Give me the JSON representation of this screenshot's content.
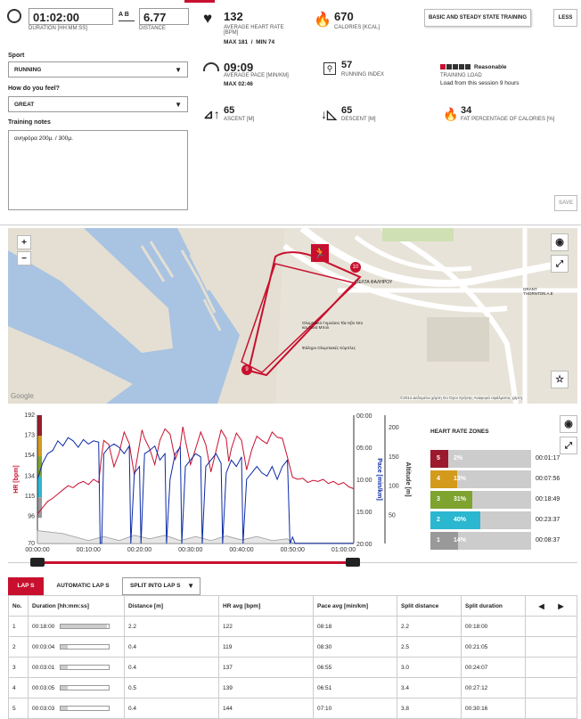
{
  "summary": {
    "duration": {
      "value": "01:02:00",
      "label": "DURATION [hh:mm:ss]"
    },
    "distance": {
      "icon_text": "A B",
      "value": "6.77",
      "label": "DISTANCE"
    },
    "avg_hr": {
      "value": "132",
      "label": "AVERAGE HEART RATE [bpm]",
      "sub": "MAX 181  /  MIN 74"
    },
    "calories": {
      "value": "670",
      "label": "CALORIES [kcal]"
    },
    "avg_pace": {
      "value": "09:09",
      "label": "AVERAGE PACE [min/km]",
      "sub": "MAX 02:46"
    },
    "running_index": {
      "value": "57",
      "label": "RUNNING INDEX"
    },
    "training_load": {
      "value": "Reasonable",
      "label": "TRAINING LOAD",
      "sub": "Load from this session 9 hours"
    },
    "ascent": {
      "value": "65",
      "label": "ASCENT [m]"
    },
    "descent": {
      "value": "65",
      "label": "DESCENT [m]"
    },
    "fat": {
      "value": "34",
      "label": "FAT PERCENTAGE OF CALORIES [%]"
    },
    "target_button": "BASIC AND STEADY STATE TRAINING",
    "less_button": "LESS",
    "save_button": "SAVE"
  },
  "form": {
    "sport_label": "Sport",
    "sport_value": "RUNNING",
    "feel_label": "How do you feel?",
    "feel_value": "GREAT",
    "notes_label": "Training notes",
    "notes_value": "ανηφόρα 200μ. / 300μ."
  },
  "map": {
    "zoom_in": "+",
    "zoom_out": "−",
    "google": "Google",
    "copyright": "©2014 Δεδομένα χάρτη Go  Όροι Χρήσης  Αναφορά σφάλματος χάρτη",
    "place_station": "ΔΕΛΤΑ ΦΑΛΗΡΟΥ",
    "place_stadium": "Ολυμπιακό Γυμνάσιο Τάε Κβο Ντο και Ξανά Μπολ",
    "place_complex": "Φάληρο Ολυμπιακές Κόμπλες",
    "place_grant": "GRANT THORNTON A.E",
    "marker_start": "9",
    "marker_end": "10"
  },
  "chart_data": {
    "type": "line",
    "x_ticks": [
      "00:00:00",
      "00:10:00",
      "00:20:00",
      "00:30:00",
      "00:40:00",
      "00:50:00",
      "01:00:00"
    ],
    "hr_axis": {
      "label": "HR [bpm]",
      "ticks": [
        "192",
        "173",
        "154",
        "134",
        "115",
        "96",
        "70"
      ]
    },
    "pace_axis": {
      "label": "Pace [min/km]",
      "ticks": [
        "00:00",
        "05:00",
        "10:00",
        "15:00",
        "20:00"
      ]
    },
    "alt_axis": {
      "label": "Altitude [m]",
      "ticks": [
        "200",
        "150",
        "100",
        "50"
      ]
    },
    "xlim": [
      0,
      62
    ],
    "series": [
      {
        "name": "HR [bpm]",
        "color": "#c8102e",
        "x": [
          0,
          1,
          2,
          3,
          4,
          5,
          6,
          7,
          8,
          9,
          10,
          11,
          12,
          12.5,
          13,
          14,
          15,
          16,
          17,
          18,
          19,
          20,
          20.5,
          21,
          22,
          23,
          24,
          25,
          26,
          27,
          28,
          28.5,
          29,
          30,
          31,
          32,
          33,
          34,
          35,
          36,
          37,
          37.5,
          38,
          39,
          40,
          41,
          42,
          43,
          44,
          45,
          46,
          47,
          48,
          49,
          50,
          51,
          52,
          53,
          54,
          55,
          56,
          57,
          58,
          59,
          60,
          61,
          62
        ],
        "values": [
          98,
          104,
          110,
          113,
          117,
          121,
          125,
          123,
          127,
          129,
          126,
          131,
          128,
          150,
          168,
          164,
          143,
          156,
          176,
          165,
          135,
          164,
          178,
          170,
          160,
          145,
          168,
          179,
          174,
          150,
          163,
          181,
          168,
          145,
          160,
          176,
          164,
          138,
          158,
          178,
          170,
          148,
          160,
          175,
          168,
          140,
          159,
          172,
          168,
          165,
          176,
          171,
          170,
          152,
          133,
          131,
          132,
          128,
          130,
          129,
          131,
          127,
          129,
          126,
          128,
          124,
          122
        ]
      },
      {
        "name": "Pace [min/km]",
        "color": "#0a2aa6",
        "x": [
          0,
          1,
          2,
          3,
          4,
          5,
          6,
          7,
          8,
          9,
          10,
          11,
          12,
          12.3,
          12.6,
          13,
          14,
          15,
          16,
          17,
          18,
          18.3,
          19,
          20,
          20.3,
          21,
          22,
          23,
          24,
          25,
          25.3,
          26,
          27,
          28,
          28.3,
          29,
          30,
          31,
          32,
          32.3,
          33,
          34,
          35,
          36,
          36.3,
          37,
          38,
          39,
          40,
          40.3,
          41,
          42,
          43,
          44,
          45,
          46,
          47,
          48,
          49,
          49.5,
          50,
          50.5,
          51,
          52,
          53,
          54,
          55,
          56,
          57,
          58,
          59,
          60,
          61,
          62
        ],
        "values": [
          10,
          7.5,
          6,
          5.5,
          4,
          4.8,
          3.5,
          4,
          5,
          3.8,
          4.5,
          4,
          4.2,
          20,
          20,
          6,
          5,
          4.5,
          5,
          6,
          4.8,
          20,
          9,
          8,
          20,
          6,
          5.5,
          4.8,
          7,
          6,
          20,
          10,
          6,
          5,
          20,
          8,
          7,
          6,
          6.5,
          20,
          8,
          7,
          6,
          7.5,
          20,
          9,
          7,
          8,
          6.5,
          20,
          10,
          9,
          8,
          9,
          9.5,
          8,
          10,
          8,
          7,
          20,
          19,
          20,
          20,
          20,
          20,
          20,
          20,
          20,
          20,
          20,
          20,
          20,
          20,
          20
        ]
      },
      {
        "name": "Altitude [m]",
        "color": "#999999",
        "x": [
          0,
          5,
          10,
          13,
          16,
          19,
          22,
          25,
          28,
          31,
          34,
          37,
          40,
          43,
          46,
          49,
          50,
          52,
          56,
          62
        ],
        "values": [
          22,
          17,
          5,
          12,
          5,
          14,
          8,
          14,
          5,
          12,
          5,
          13,
          6,
          12,
          5,
          8,
          1,
          1,
          1,
          1
        ]
      }
    ],
    "hr_range": [
      70,
      192
    ],
    "pace_range": [
      0,
      20
    ],
    "alt_range": [
      0,
      220
    ]
  },
  "zones": {
    "title": "HEART RATE ZONES",
    "items": [
      {
        "zone": "5",
        "pct": "2%",
        "frac": 0.02,
        "time": "00:01:17",
        "color": "#9c1a2e"
      },
      {
        "zone": "4",
        "pct": "13%",
        "frac": 0.13,
        "time": "00:07:56",
        "color": "#d39a1c"
      },
      {
        "zone": "3",
        "pct": "31%",
        "frac": 0.31,
        "time": "00:18:49",
        "color": "#7ea32f"
      },
      {
        "zone": "2",
        "pct": "40%",
        "frac": 0.4,
        "time": "00:23:37",
        "color": "#2ab7cf"
      },
      {
        "zone": "1",
        "pct": "14%",
        "frac": 0.14,
        "time": "00:08:37",
        "color": "#999999"
      }
    ]
  },
  "laps": {
    "tabs": [
      "LAP S",
      "AUTOMATIC LAP S",
      "SPLIT INTO LAP S"
    ],
    "headers": [
      "No.",
      "Duration [hh:mm:ss]",
      "Distance [m]",
      "HR avg [bpm]",
      "Pace avg [min/km]",
      "Split distance",
      "Split duration"
    ],
    "rows": [
      {
        "no": "1",
        "dur": "00:18:00",
        "bar": 0.95,
        "dist": "2.2",
        "hr": "122",
        "pace": "08:18",
        "sdist": "2.2",
        "sdur": "00:18:00"
      },
      {
        "no": "2",
        "dur": "00:03:04",
        "bar": 0.15,
        "dist": "0.4",
        "hr": "119",
        "pace": "08:30",
        "sdist": "2.5",
        "sdur": "00:21:05"
      },
      {
        "no": "3",
        "dur": "00:03:01",
        "bar": 0.14,
        "dist": "0.4",
        "hr": "137",
        "pace": "06:55",
        "sdist": "3.0",
        "sdur": "00:24:07"
      },
      {
        "no": "4",
        "dur": "00:03:05",
        "bar": 0.15,
        "dist": "0.5",
        "hr": "139",
        "pace": "06:51",
        "sdist": "3.4",
        "sdur": "00:27:12"
      },
      {
        "no": "5",
        "dur": "00:03:03",
        "bar": 0.14,
        "dist": "0.4",
        "hr": "144",
        "pace": "07:10",
        "sdist": "3.8",
        "sdur": "00:30:16"
      }
    ]
  }
}
